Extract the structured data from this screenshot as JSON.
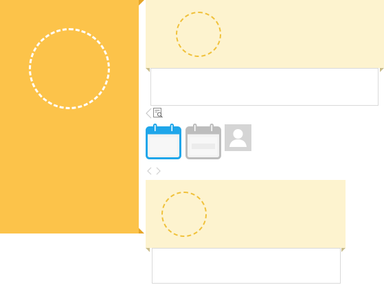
{
  "colors": {
    "orange_card": "#fcc34a",
    "orange_fold": "#e6a528",
    "pale_card": "#fdf3cf",
    "pale_circle": "#f0c13a",
    "box_border": "#d9d9d9",
    "calendar_active": "#1fa6ea",
    "calendar_inactive": "#bdbdbd",
    "avatar_bg": "#d5d5d5"
  },
  "icons": {
    "back": "chevron-left-icon",
    "doc_search": "document-search-icon",
    "calendar_active": "calendar-icon",
    "calendar_inactive": "calendar-icon",
    "avatar": "user-avatar-icon",
    "prev_next": "chevron-left-right-icon"
  }
}
